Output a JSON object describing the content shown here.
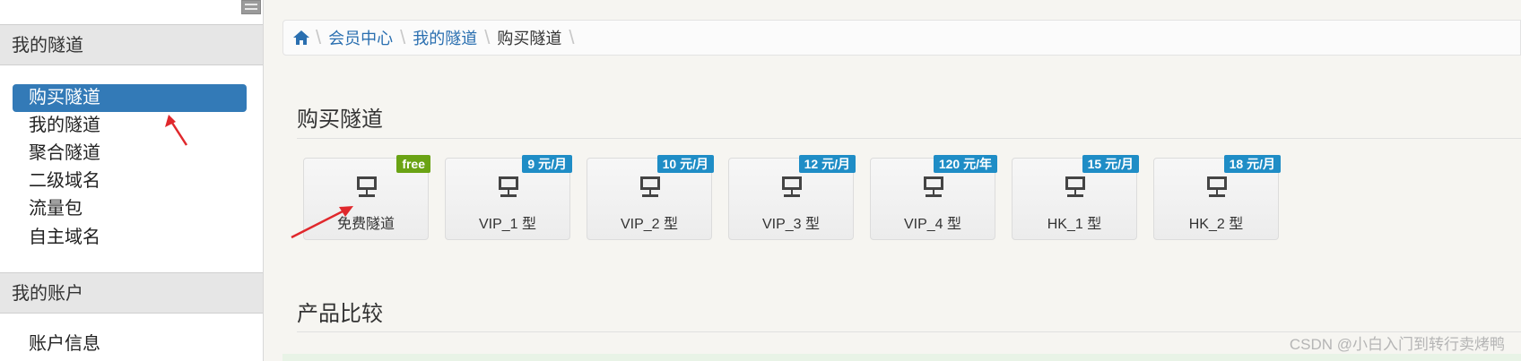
{
  "sidebar": {
    "sections": [
      {
        "title": "我的隧道",
        "items": [
          {
            "label": "购买隧道",
            "active": true
          },
          {
            "label": "我的隧道"
          },
          {
            "label": "聚合隧道"
          },
          {
            "label": "二级域名"
          },
          {
            "label": "流量包"
          },
          {
            "label": "自主域名"
          }
        ]
      },
      {
        "title": "我的账户",
        "items": [
          {
            "label": "账户信息"
          }
        ]
      }
    ]
  },
  "breadcrumb": [
    "会员中心",
    "我的隧道",
    "购买隧道"
  ],
  "page": {
    "title": "购买隧道",
    "cards": [
      {
        "label": "免费隧道",
        "badge": "free"
      },
      {
        "label": "VIP_1 型",
        "badge": "9 元/月"
      },
      {
        "label": "VIP_2 型",
        "badge": "10 元/月"
      },
      {
        "label": "VIP_3 型",
        "badge": "12 元/月"
      },
      {
        "label": "VIP_4 型",
        "badge": "120 元/年"
      },
      {
        "label": "HK_1 型",
        "badge": "15 元/月"
      },
      {
        "label": "HK_2 型",
        "badge": "18 元/月"
      }
    ],
    "section2_title": "产品比较"
  },
  "watermark": "CSDN @小白入门到转行卖烤鸭",
  "colors": {
    "accent": "#337ab7",
    "badge_blue": "#1f8dc6",
    "badge_green": "#6aa314",
    "annotation_red": "#e0282c"
  }
}
